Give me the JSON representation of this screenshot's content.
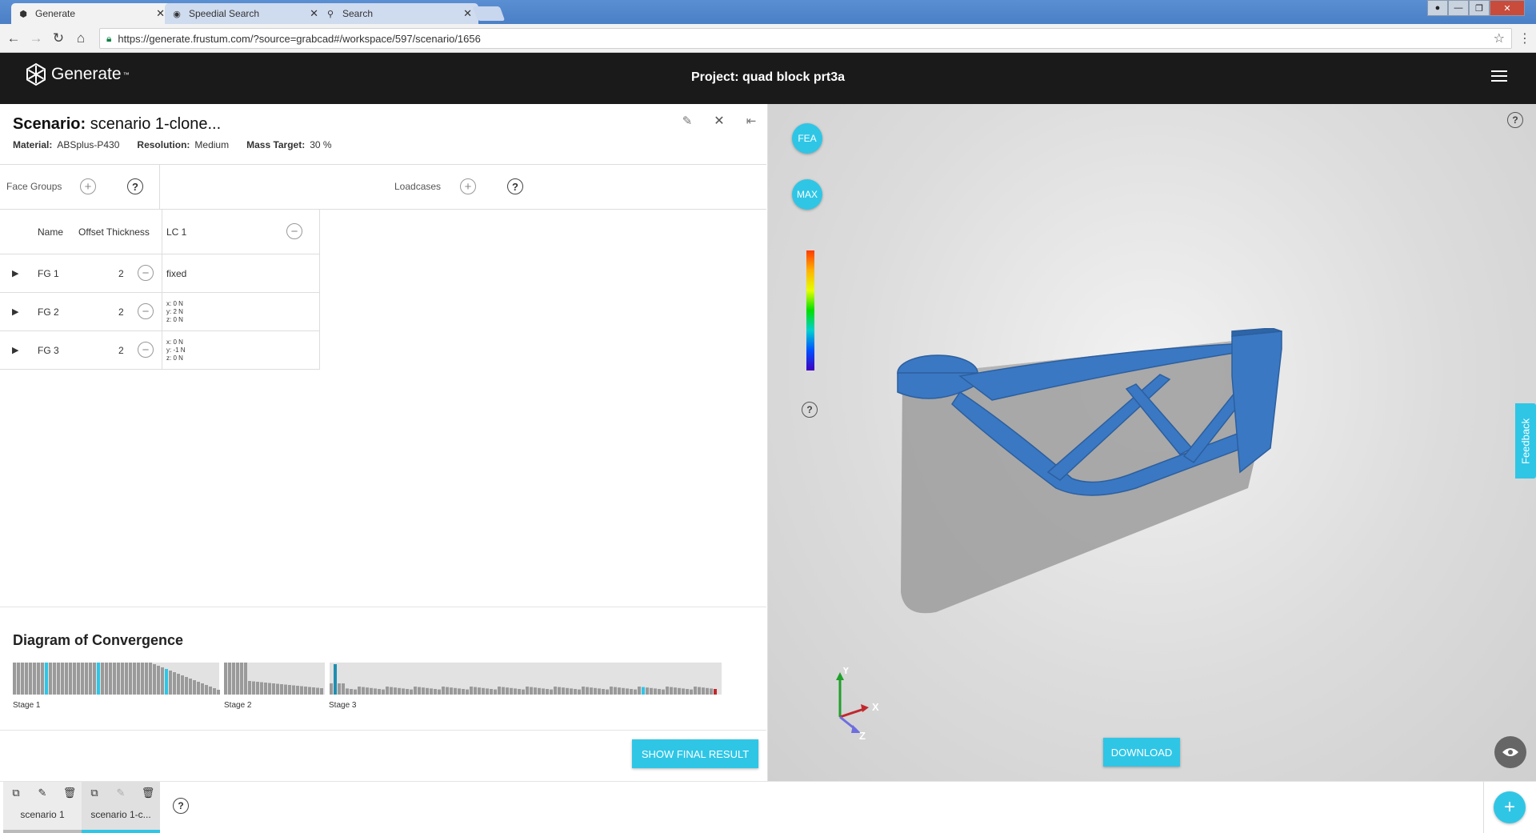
{
  "browser": {
    "tabs": [
      {
        "title": "Generate",
        "active": true
      },
      {
        "title": "Speedial Search",
        "active": false
      },
      {
        "title": "Search",
        "active": false
      }
    ],
    "url": "https://generate.frustum.com/?source=grabcad#/workspace/597/scenario/1656"
  },
  "header": {
    "logo_text": "Generate",
    "logo_tm": "™",
    "project_title": "Project: quad block prt3a"
  },
  "scenario": {
    "label": "Scenario:",
    "name": "scenario 1-clone...",
    "material_label": "Material:",
    "material": "ABSplus-P430",
    "resolution_label": "Resolution:",
    "resolution": "Medium",
    "mass_label": "Mass Target:",
    "mass": "30 %"
  },
  "face_groups": {
    "label": "Face Groups",
    "loadcases_label": "Loadcases",
    "columns": {
      "name": "Name",
      "offset": "Offset Thickness",
      "lc": "LC 1"
    },
    "rows": [
      {
        "name": "FG 1",
        "offset": "2",
        "lc_text": "fixed"
      },
      {
        "name": "FG 2",
        "offset": "2",
        "lc_x": "x: 0 N",
        "lc_y": "y: 2 N",
        "lc_z": "z: 0 N"
      },
      {
        "name": "FG 3",
        "offset": "2",
        "lc_x": "x: 0 N",
        "lc_y": "y: -1 N",
        "lc_z": "z: 0 N"
      }
    ]
  },
  "convergence": {
    "title": "Diagram of Convergence",
    "stages": [
      "Stage 1",
      "Stage 2",
      "Stage 3"
    ],
    "show_final_label": "SHOW FINAL RESULT"
  },
  "viewport": {
    "fea_label": "FEA",
    "max_label": "MAX",
    "download_label": "DOWNLOAD",
    "feedback_label": "Feedback",
    "axis_x": "X",
    "axis_y": "Y",
    "axis_z": "Z",
    "colors": {
      "accent": "#2fc6e6",
      "model": "#3a78c4",
      "bounding": "#9a9a9a"
    }
  },
  "bottom": {
    "tabs": [
      {
        "name": "scenario 1",
        "active": false
      },
      {
        "name": "scenario 1-c...",
        "active": true
      }
    ],
    "help": "?"
  },
  "icons": {
    "help": "?",
    "plus": "+",
    "minus": "−",
    "expand": "▶",
    "close": "✕",
    "edit": "✎",
    "collapse": "⇤"
  }
}
